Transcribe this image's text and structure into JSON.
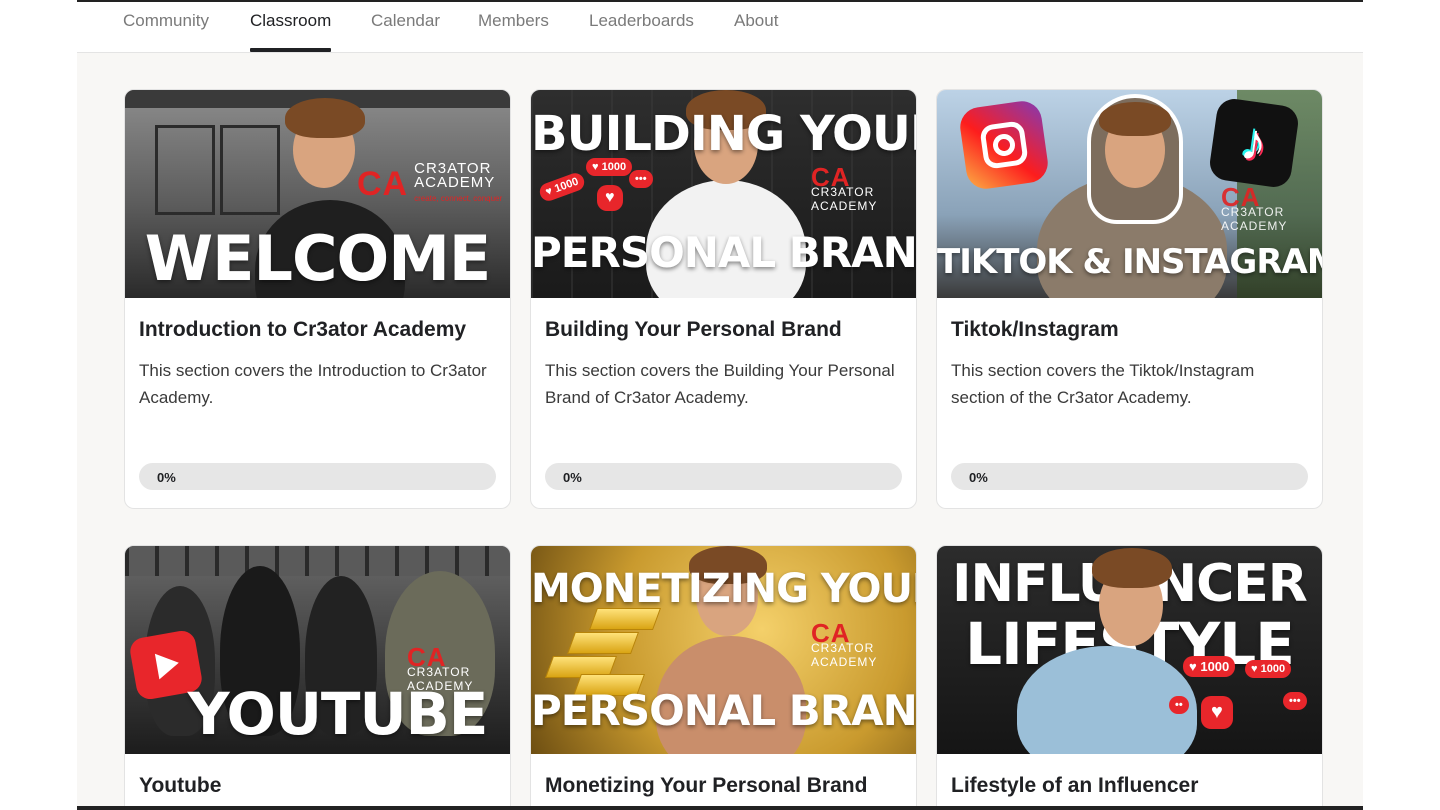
{
  "nav": {
    "tabs": [
      {
        "label": "Community"
      },
      {
        "label": "Classroom",
        "active": true
      },
      {
        "label": "Calendar"
      },
      {
        "label": "Members"
      },
      {
        "label": "Leaderboards"
      },
      {
        "label": "About"
      }
    ]
  },
  "brand": {
    "mark": "CA",
    "name_line1": "CR3ATOR",
    "name_line2": "ACADEMY",
    "tagline": "create, connect, conquer"
  },
  "courses": [
    {
      "title": "Introduction to Cr3ator Academy",
      "description": "This section covers the Introduction to Cr3ator Academy.",
      "progress_label": "0%",
      "progress": 0,
      "thumbnail_text": [
        "WELCOME"
      ]
    },
    {
      "title": "Building Your Personal Brand",
      "description": "This section covers the Building Your Personal Brand of Cr3ator Academy.",
      "progress_label": "0%",
      "progress": 0,
      "thumbnail_text": [
        "BUILDING YOUR",
        "PERSONAL BRAND"
      ],
      "thumbnail_badges": [
        "1000",
        "1000"
      ]
    },
    {
      "title": "Tiktok/Instagram",
      "description": "This section covers the Tiktok/Instagram section of the Cr3ator Academy.",
      "progress_label": "0%",
      "progress": 0,
      "thumbnail_text": [
        "TIKTOK & INSTAGRAM"
      ]
    },
    {
      "title": "Youtube",
      "thumbnail_text": [
        "YOUTUBE"
      ]
    },
    {
      "title": "Monetizing Your Personal Brand",
      "thumbnail_text": [
        "MONETIZING YOUR",
        "PERSONAL BRAND"
      ]
    },
    {
      "title": "Lifestyle of an Influencer",
      "thumbnail_text": [
        "INFLUENCER",
        "LIFESTYLE"
      ],
      "thumbnail_badges": [
        "1000",
        "1000"
      ]
    }
  ],
  "icons": {
    "instagram": "instagram-logo-icon",
    "tiktok": "tiktok-logo-icon",
    "youtube": "youtube-play-icon",
    "heart": "heart-icon"
  },
  "colors": {
    "accent_red": "#e8262b",
    "active_tab": "#202124",
    "inactive_tab": "#7a7a7a",
    "progress_track": "#e6e6e6"
  }
}
